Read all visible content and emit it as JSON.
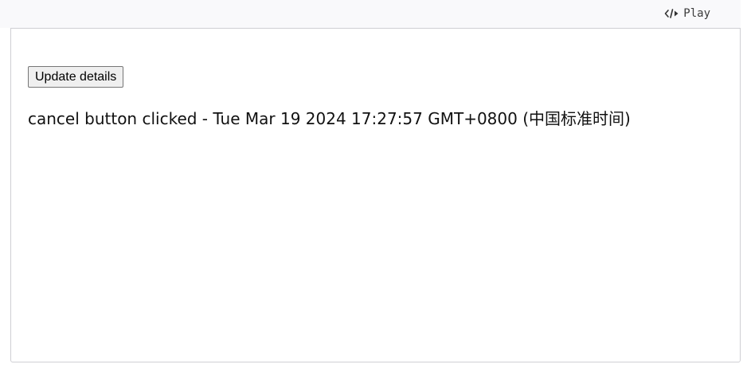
{
  "header": {
    "play_label": "Play",
    "play_icon": "code-play-icon"
  },
  "demo": {
    "update_button_label": "Update details",
    "status_text": "cancel button clicked - Tue Mar 19 2024 17:27:57 GMT+0800 (中国标准时间)"
  }
}
